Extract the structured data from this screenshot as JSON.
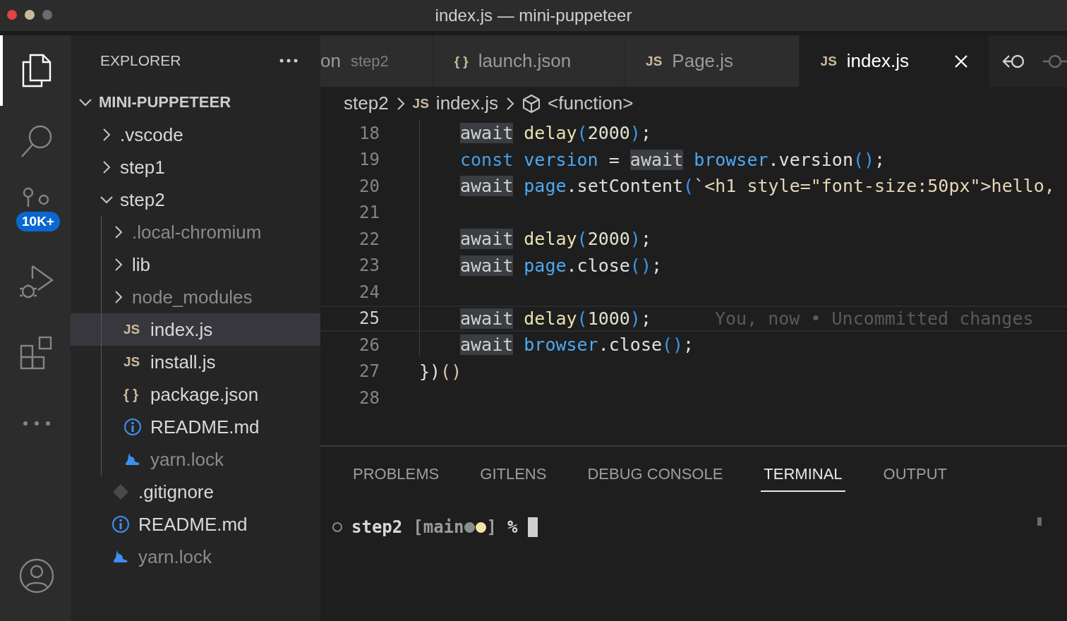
{
  "window": {
    "title": "index.js — mini-puppeteer",
    "controls": [
      {
        "color": "#e0443e"
      },
      {
        "color": "#c9b99a"
      },
      {
        "color": "#6b6b6b"
      }
    ]
  },
  "activity_bar": {
    "items": [
      {
        "kind": "files",
        "selected": true
      },
      {
        "kind": "search",
        "selected": false
      },
      {
        "kind": "source-control",
        "selected": false,
        "badge": "10K+"
      },
      {
        "kind": "debug",
        "selected": false
      },
      {
        "kind": "extensions",
        "selected": false
      },
      {
        "kind": "more",
        "selected": false
      }
    ],
    "account": {
      "kind": "account"
    }
  },
  "sidebar": {
    "title": "EXPLORER",
    "root": {
      "label": "MINI-PUPPETEER",
      "expanded": true
    },
    "tree": [
      {
        "kind": "folder",
        "label": ".vscode",
        "expanded": false,
        "ignored": false,
        "selected": false
      },
      {
        "kind": "folder",
        "label": "step1",
        "expanded": false,
        "ignored": false,
        "selected": false
      },
      {
        "kind": "folder",
        "label": "step2",
        "expanded": true,
        "ignored": false,
        "selected": false,
        "children": [
          {
            "kind": "folder",
            "label": ".local-chromium",
            "expanded": false,
            "ignored": true,
            "selected": false
          },
          {
            "kind": "folder",
            "label": "lib",
            "expanded": false,
            "ignored": false,
            "selected": false
          },
          {
            "kind": "folder",
            "label": "node_modules",
            "expanded": false,
            "ignored": true,
            "selected": false
          },
          {
            "kind": "glyph",
            "glyph": "JS",
            "label": "index.js",
            "ignored": false,
            "selected": true
          },
          {
            "kind": "glyph",
            "glyph": "JS",
            "label": "install.js",
            "ignored": false,
            "selected": false
          },
          {
            "kind": "glyph",
            "glyph": "{ }",
            "label": "package.json",
            "ignored": false,
            "selected": false
          },
          {
            "kind": "info",
            "label": "README.md",
            "ignored": false,
            "selected": false
          },
          {
            "kind": "yarn",
            "label": "yarn.lock",
            "ignored": true,
            "selected": false
          }
        ]
      },
      {
        "kind": "git",
        "label": ".gitignore",
        "ignored": false,
        "selected": false
      },
      {
        "kind": "info",
        "label": "README.md",
        "ignored": false,
        "selected": false
      },
      {
        "kind": "yarn",
        "label": "yarn.lock",
        "ignored": true,
        "selected": false
      }
    ]
  },
  "tabs": [
    {
      "label": "on",
      "description": "step2",
      "selected": false
    },
    {
      "glyph": "{ }",
      "label": "launch.json",
      "selected": false
    },
    {
      "glyph": "JS",
      "label": "Page.js",
      "selected": false
    },
    {
      "glyph": "JS",
      "label": "index.js",
      "selected": true,
      "closable": true
    }
  ],
  "breadcrumb": [
    {
      "kind": "folder",
      "label": "step2"
    },
    {
      "kind": "file",
      "glyph": "JS",
      "label": "index.js"
    },
    {
      "kind": "symbol",
      "label": "<function>"
    }
  ],
  "code": [
    {
      "number": "18",
      "kind": "body",
      "current": false,
      "tokens": [
        {
          "kind": "await",
          "t": "await"
        },
        {
          "kind": "function",
          "t": " delay"
        },
        {
          "kind": "bracket",
          "t": "("
        },
        {
          "kind": "number",
          "t": "2000"
        },
        {
          "kind": "bracket",
          "t": ")"
        },
        {
          "kind": "plain",
          "t": ";"
        }
      ]
    },
    {
      "number": "19",
      "kind": "body",
      "current": false,
      "tokens": [
        {
          "kind": "keyword",
          "t": "const"
        },
        {
          "kind": "variable",
          "t": " version"
        },
        {
          "kind": "plain",
          "t": " = "
        },
        {
          "kind": "await",
          "t": "await"
        },
        {
          "kind": "variable",
          "t": " browser"
        },
        {
          "kind": "plain",
          "t": ".version"
        },
        {
          "kind": "bracket",
          "t": "()"
        },
        {
          "kind": "plain",
          "t": ";"
        }
      ]
    },
    {
      "number": "20",
      "kind": "body",
      "current": false,
      "tokens": [
        {
          "kind": "await",
          "t": "await"
        },
        {
          "kind": "variable",
          "t": " page"
        },
        {
          "kind": "plain",
          "t": ".setContent"
        },
        {
          "kind": "bracket",
          "t": "("
        },
        {
          "kind": "string",
          "t": "`<h1 style=\"font-size:50px\">hello,"
        }
      ]
    },
    {
      "number": "21",
      "current": false
    },
    {
      "number": "22",
      "kind": "body",
      "current": false,
      "tokens": [
        {
          "kind": "await",
          "t": "await"
        },
        {
          "kind": "function",
          "t": " delay"
        },
        {
          "kind": "bracket",
          "t": "("
        },
        {
          "kind": "number",
          "t": "2000"
        },
        {
          "kind": "bracket",
          "t": ")"
        },
        {
          "kind": "plain",
          "t": ";"
        }
      ]
    },
    {
      "number": "23",
      "kind": "body",
      "current": false,
      "tokens": [
        {
          "kind": "await",
          "t": "await"
        },
        {
          "kind": "variable",
          "t": " page"
        },
        {
          "kind": "plain",
          "t": ".close"
        },
        {
          "kind": "bracket",
          "t": "()"
        },
        {
          "kind": "plain",
          "t": ";"
        }
      ]
    },
    {
      "number": "24",
      "current": false
    },
    {
      "number": "25",
      "kind": "body",
      "current": true,
      "tokens": [
        {
          "kind": "await",
          "t": "await"
        },
        {
          "kind": "function",
          "t": " delay"
        },
        {
          "kind": "bracket",
          "t": "("
        },
        {
          "kind": "number",
          "t": "1000"
        },
        {
          "kind": "bracket",
          "t": ")"
        },
        {
          "kind": "plain",
          "t": ";"
        }
      ],
      "annotation": "You, now • Uncommitted changes"
    },
    {
      "number": "26",
      "kind": "body",
      "current": false,
      "tokens": [
        {
          "kind": "await",
          "t": "await"
        },
        {
          "kind": "variable",
          "t": " browser"
        },
        {
          "kind": "plain",
          "t": ".close"
        },
        {
          "kind": "bracket",
          "t": "()"
        },
        {
          "kind": "plain",
          "t": ";"
        }
      ]
    },
    {
      "number": "27",
      "kind": "top",
      "current": false,
      "tokens": [
        {
          "kind": "plain",
          "t": "})"
        },
        {
          "kind": "paren",
          "t": "()"
        }
      ]
    },
    {
      "number": "28",
      "current": false
    }
  ],
  "panel": {
    "tabs": [
      {
        "label": "PROBLEMS",
        "selected": false
      },
      {
        "label": "GITLENS",
        "selected": false
      },
      {
        "label": "DEBUG CONSOLE",
        "selected": false
      },
      {
        "label": "TERMINAL",
        "selected": true
      },
      {
        "label": "OUTPUT",
        "selected": false
      }
    ],
    "terminal": {
      "directory": "step2",
      "branch_open": "[main",
      "status_dots": [
        {
          "color": "#8a9089"
        },
        {
          "color": "#f3e3a8"
        }
      ],
      "branch_close": "]",
      "symbol": "%"
    }
  }
}
